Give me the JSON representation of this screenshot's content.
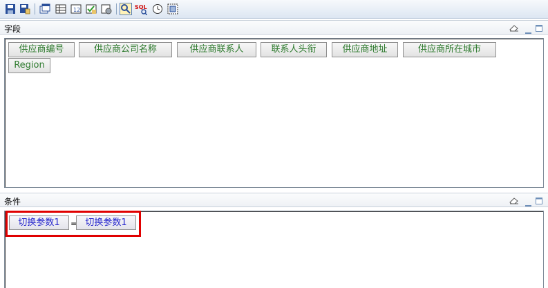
{
  "toolbar": {
    "buttons": [
      {
        "name": "save-icon"
      },
      {
        "name": "save-as-icon"
      },
      {
        "name": "window-icon"
      },
      {
        "name": "table-icon"
      },
      {
        "name": "parameter-icon"
      },
      {
        "name": "check-icon"
      },
      {
        "name": "settings-icon"
      },
      {
        "name": "search-icon"
      },
      {
        "name": "sql-icon",
        "label": "SQL"
      },
      {
        "name": "clock-icon"
      },
      {
        "name": "grid-icon"
      }
    ]
  },
  "fields_panel": {
    "title": "字段",
    "fields": [
      "供应商编号",
      "供应商公司名称",
      "供应商联系人",
      "联系人头衔",
      "供应商地址",
      "供应商所在城市",
      "Region"
    ]
  },
  "conditions_panel": {
    "title": "条件",
    "condition": {
      "left": "切换参数1",
      "operator": "=",
      "right": "切换参数1"
    }
  },
  "colors": {
    "field_text": "#2d7a2d",
    "condition_text": "#2222cc",
    "highlight": "#e00000"
  }
}
